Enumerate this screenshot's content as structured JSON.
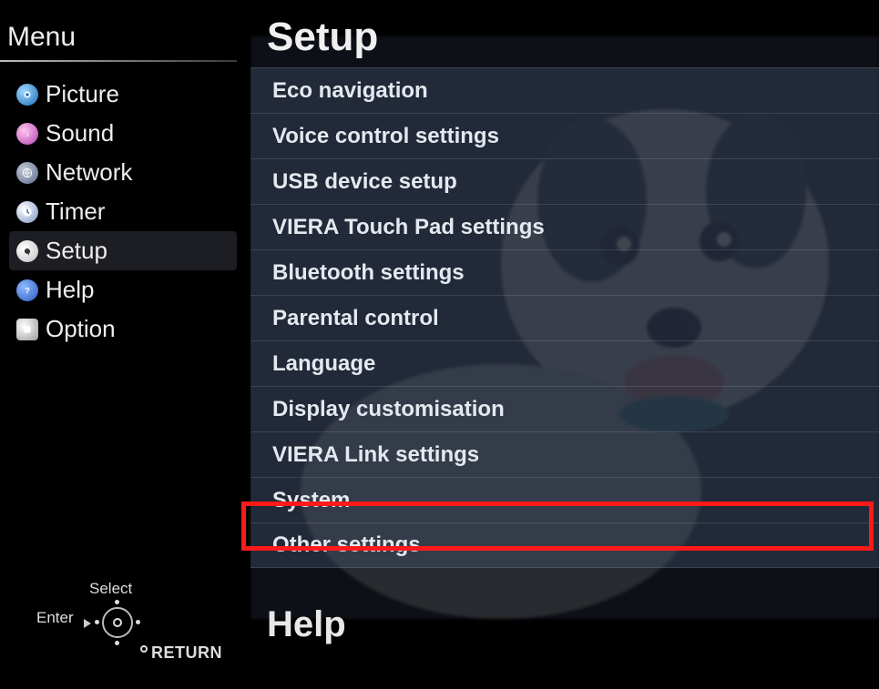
{
  "sidebar": {
    "title": "Menu",
    "items": [
      {
        "label": "Picture",
        "icon": "picture-icon",
        "selected": false
      },
      {
        "label": "Sound",
        "icon": "sound-icon",
        "selected": false
      },
      {
        "label": "Network",
        "icon": "network-icon",
        "selected": false
      },
      {
        "label": "Timer",
        "icon": "timer-icon",
        "selected": false
      },
      {
        "label": "Setup",
        "icon": "setup-icon",
        "selected": true
      },
      {
        "label": "Help",
        "icon": "help-icon",
        "selected": false
      },
      {
        "label": "Option",
        "icon": "option-icon",
        "selected": false
      }
    ]
  },
  "nav_hint": {
    "select": "Select",
    "enter": "Enter",
    "return": "RETURN"
  },
  "main": {
    "section_title": "Setup",
    "options": [
      "Eco navigation",
      "Voice control settings",
      "USB device setup",
      "VIERA Touch Pad settings",
      "Bluetooth settings",
      "Parental control",
      "Language",
      "Display customisation",
      "VIERA Link settings",
      "System",
      "Other settings"
    ],
    "highlighted_index": 9,
    "secondary_title": "Help"
  },
  "colors": {
    "highlight": "#ff1a1a",
    "panel_tint": "rgba(80,96,130,.32)"
  }
}
